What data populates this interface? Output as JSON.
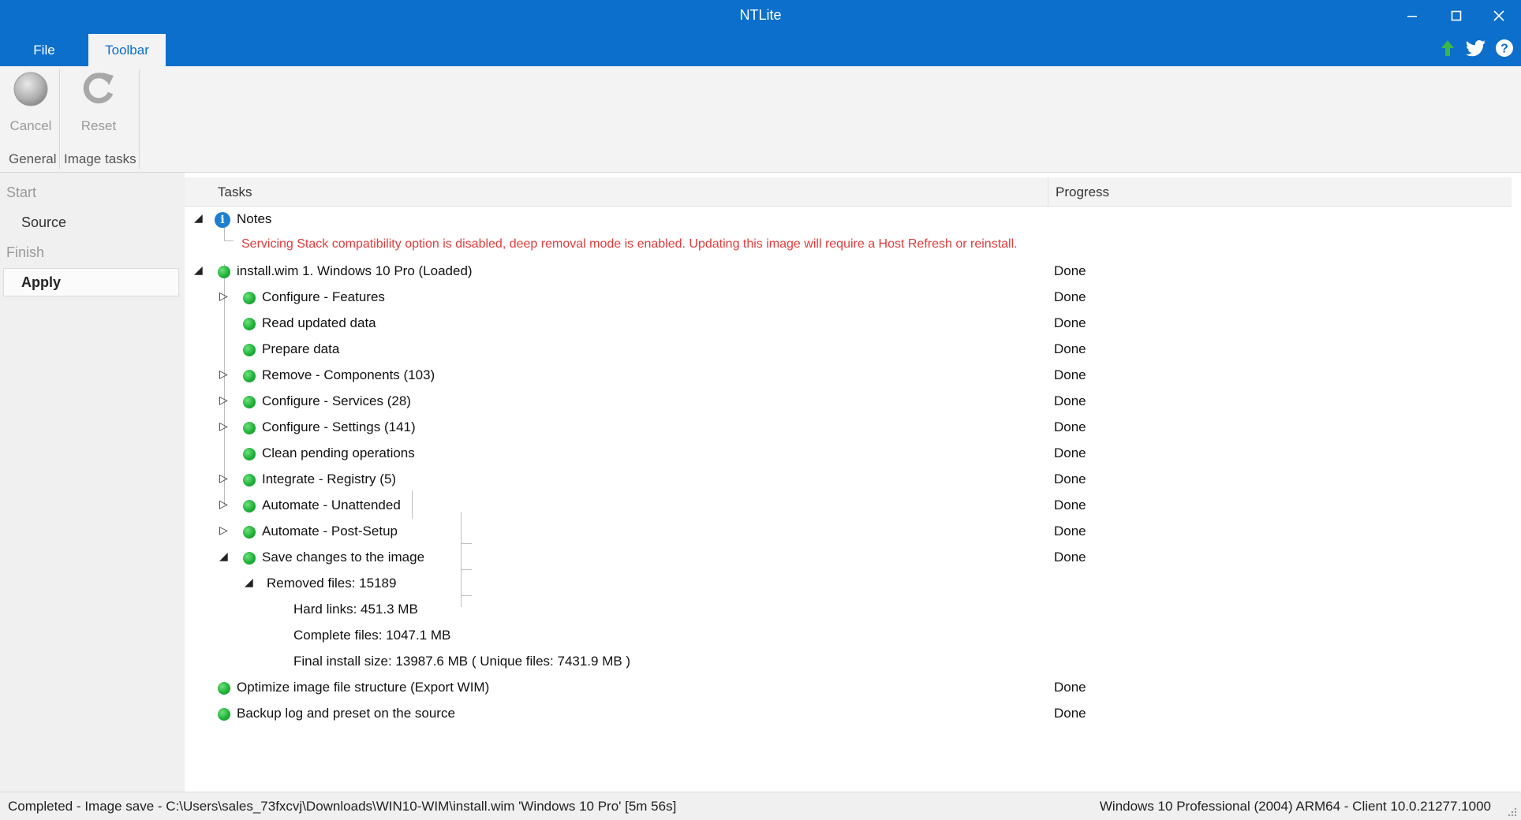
{
  "window": {
    "title": "NTLite",
    "minimize": "—",
    "maximize": "☐",
    "close": "✕"
  },
  "ribbon": {
    "tabs": [
      {
        "label": "File"
      },
      {
        "label": "Toolbar",
        "active": true
      }
    ],
    "buttons": [
      {
        "label": "Cancel",
        "icon": "cancel-circle-icon",
        "enabled": false
      },
      {
        "label": "Reset",
        "icon": "refresh-icon",
        "enabled": false
      }
    ],
    "groups": [
      "General",
      "Image tasks"
    ],
    "top_right_icons": [
      "update-arrow-icon",
      "twitter-icon",
      "help-icon"
    ]
  },
  "nav": {
    "start": "Start",
    "source": "Source",
    "finish": "Finish",
    "apply": "Apply"
  },
  "tasks": {
    "header_tasks": "Tasks",
    "header_progress": "Progress",
    "notes_label": "Notes",
    "notes_warning": "Servicing Stack compatibility option is disabled, deep removal mode is enabled. Updating this image will require a Host Refresh or reinstall.",
    "image_label": "install.wim 1. Windows 10 Pro  (Loaded)",
    "image_progress": "Done",
    "children": [
      {
        "label": "Configure - Features",
        "progress": "Done",
        "expandable": true
      },
      {
        "label": "Read updated data",
        "progress": "Done",
        "expandable": false
      },
      {
        "label": "Prepare data",
        "progress": "Done",
        "expandable": false
      },
      {
        "label": "Remove - Components (103)",
        "progress": "Done",
        "expandable": true
      },
      {
        "label": "Configure - Services (28)",
        "progress": "Done",
        "expandable": true
      },
      {
        "label": "Configure - Settings (141)",
        "progress": "Done",
        "expandable": true
      },
      {
        "label": "Clean pending operations",
        "progress": "Done",
        "expandable": false
      },
      {
        "label": "Integrate - Registry (5)",
        "progress": "Done",
        "expandable": true
      },
      {
        "label": "Automate - Unattended",
        "progress": "Done",
        "expandable": true
      },
      {
        "label": "Automate - Post-Setup",
        "progress": "Done",
        "expandable": true
      },
      {
        "label": "Save changes to the image",
        "progress": "Done",
        "expandable": true,
        "expanded": true
      }
    ],
    "removed_files": "Removed files: 15189",
    "removed_details": [
      "Hard links: 451.3 MB",
      "Complete files: 1047.1 MB",
      "Final install size: 13987.6 MB ( Unique files: 7431.9 MB )"
    ],
    "after": [
      {
        "label": "Optimize image file structure (Export WIM)",
        "progress": "Done"
      },
      {
        "label": "Backup log and preset on the source",
        "progress": "Done"
      }
    ]
  },
  "status": {
    "left": "Completed - Image save - C:\\Users\\sales_73fxcvj\\Downloads\\WIN10-WIM\\install.wim 'Windows 10 Pro' [5m 56s]",
    "right": "Windows 10 Professional (2004) ARM64 - Client 10.0.21277.1000"
  },
  "colors": {
    "accent": "#0b6fcb",
    "warning": "#e23b3b",
    "done_dot": "#1fb238"
  }
}
